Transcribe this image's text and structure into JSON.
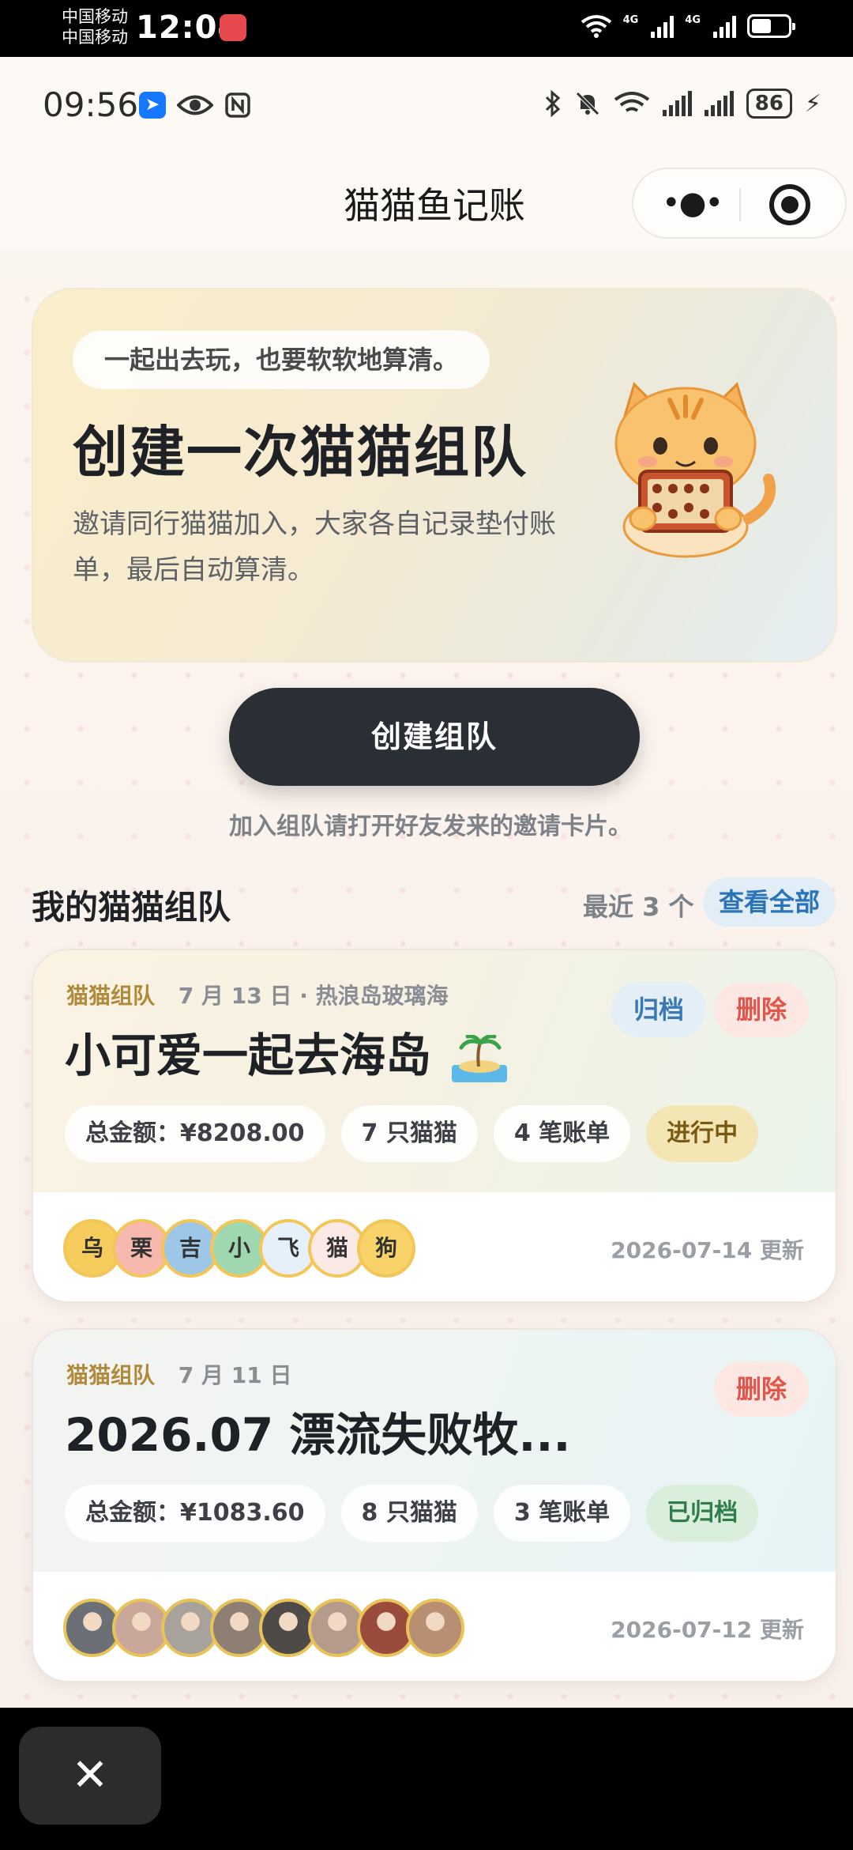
{
  "system": {
    "carrier1": "中国移动",
    "carrier2": "中国移动",
    "time": "12:04",
    "net1": "4G",
    "net2": "4G"
  },
  "inner_status": {
    "time": "09:56",
    "battery": "86"
  },
  "title_bar": {
    "title": "猫猫鱼记账",
    "more_glyph": "•●•"
  },
  "hero": {
    "pill": "一起出去玩，也要软软地算清。",
    "title": "创建一次猫猫组队",
    "description": "邀请同行猫猫加入，大家各自记录垫付账单，最后自动算清。"
  },
  "create_button": "创建组队",
  "join_hint": "加入组队请打开好友发来的邀请卡片。",
  "section": {
    "title": "我的猫猫组队",
    "count": "最近 3 个",
    "view_all": "查看全部"
  },
  "teams": [
    {
      "tag": "猫猫组队",
      "meta": "7 月 13 日 · 热浪岛玻璃海",
      "name": "小可爱一起去海岛",
      "archive_label": "归档",
      "delete_label": "删除",
      "total": "总金额：¥8208.00",
      "members": "7 只猫猫",
      "bills": "4 笔账单",
      "status": "进行中",
      "avatars": [
        "乌",
        "栗",
        "吉",
        "小",
        "飞",
        "猫",
        "狗"
      ],
      "avatar_colors": [
        "#f6cc5c",
        "#f7b9ae",
        "#9ec6e6",
        "#9fd7b0",
        "#e6f0fb",
        "#fbe9e6",
        "#f7d36a"
      ],
      "updated": "2026-07-14 更新"
    },
    {
      "tag": "猫猫组队",
      "meta": "7 月 11 日",
      "name": "2026.07 漂流失败牧...",
      "delete_label": "删除",
      "total": "总金额：¥1083.60",
      "members": "8 只猫猫",
      "bills": "3 笔账单",
      "status": "已归档",
      "photo_colors": [
        "#6b6f76",
        "#c9a79b",
        "#a8a29c",
        "#8d7f73",
        "#4d4a47",
        "#b59b8c",
        "#9a4c3c",
        "#b98f74"
      ],
      "updated": "2026-07-12 更新"
    }
  ],
  "close_glyph": "✕"
}
